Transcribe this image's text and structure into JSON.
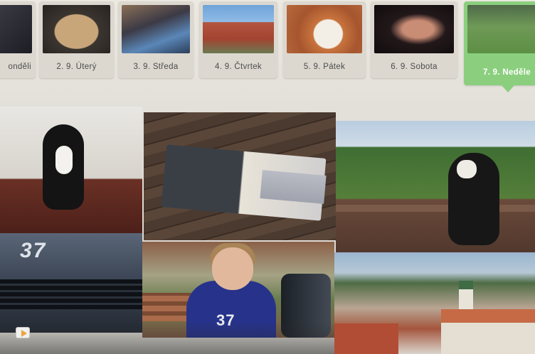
{
  "days": [
    {
      "label": "onděli",
      "thumb": "t-dark",
      "active": false
    },
    {
      "label": "2. 9. Úterý",
      "thumb": "t-tray",
      "active": false
    },
    {
      "label": "3. 9. Středa",
      "thumb": "t-girl",
      "active": false
    },
    {
      "label": "4. 9. Čtvrtek",
      "thumb": "t-house",
      "active": false
    },
    {
      "label": "5. 9. Pátek",
      "thumb": "t-plate",
      "active": false
    },
    {
      "label": "6. 9. Sobota",
      "thumb": "t-hand",
      "active": false
    },
    {
      "label": "7. 9. Neděle",
      "thumb": "t-meadow",
      "active": true
    }
  ],
  "photos": {
    "car_number": "37",
    "shirt_number": "37"
  },
  "colors": {
    "active_tab": "#8bcf7e",
    "card_bg": "#dcd8d0",
    "play_icon": "#f0a23c"
  },
  "controls": {
    "play_icon": "play-icon"
  }
}
